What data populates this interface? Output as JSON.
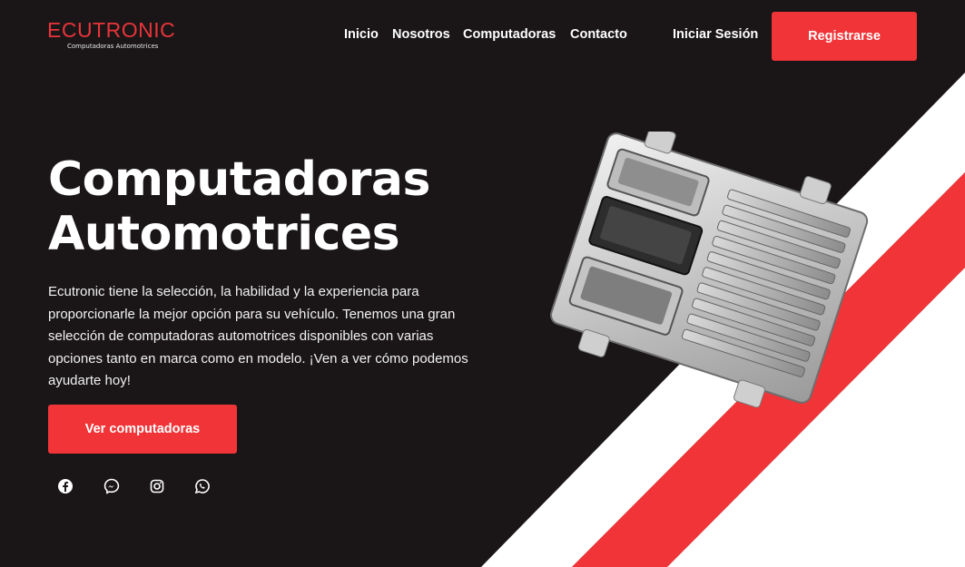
{
  "brand": {
    "name": "ECUTRONIC",
    "tagline": "Computadoras Automotrices",
    "accent_color": "#f13437"
  },
  "nav": {
    "items": [
      {
        "label": "Inicio"
      },
      {
        "label": "Nosotros"
      },
      {
        "label": "Computadoras"
      },
      {
        "label": "Contacto"
      }
    ],
    "login_label": "Iniciar Sesión",
    "register_label": "Registrarse"
  },
  "hero": {
    "title_line1": "Computadoras",
    "title_line2": "Automotrices",
    "description": "Ecutronic tiene la selección, la habilidad y la experiencia para proporcionarle la mejor opción para su vehículo. Tenemos una gran selección de computadoras automotrices disponibles con varias opciones tanto en marca como en modelo. ¡Ven a ver cómo podemos ayudarte hoy!",
    "cta_label": "Ver computadoras"
  },
  "social": [
    {
      "icon": "facebook-icon"
    },
    {
      "icon": "messenger-icon"
    },
    {
      "icon": "instagram-icon"
    },
    {
      "icon": "whatsapp-icon"
    }
  ],
  "product_image": {
    "icon": "ecu-computer-image"
  }
}
